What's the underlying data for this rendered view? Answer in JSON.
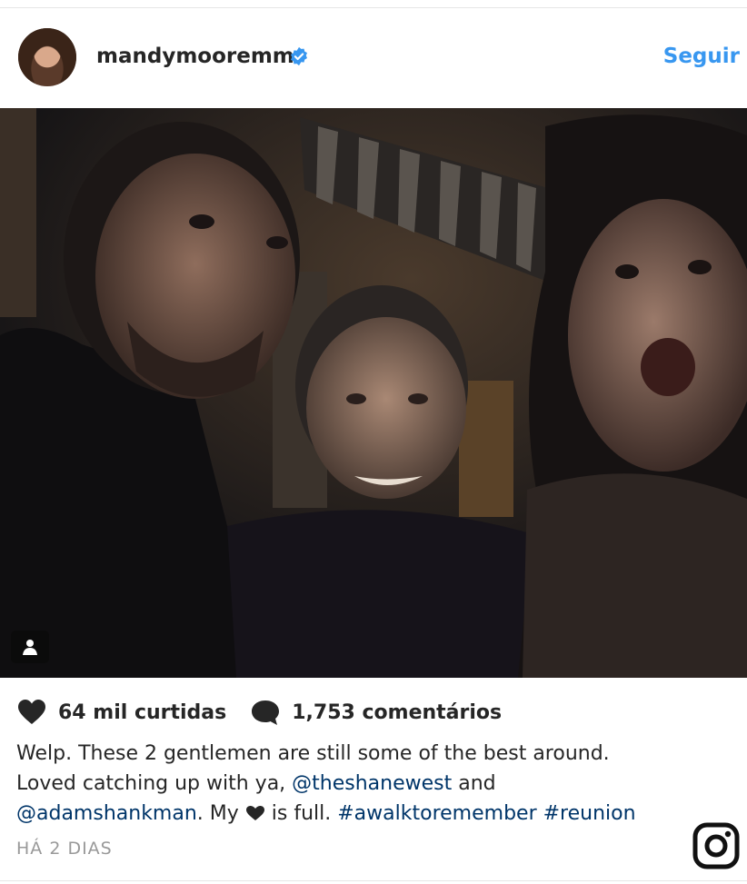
{
  "post": {
    "username": "mandymooremm",
    "follow_label": "Seguir",
    "likes_label": "64 mil curtidas",
    "comments_label": "1,753 comentários",
    "caption": {
      "line1": "Welp. These 2 gentlemen are still some of the best around.",
      "line2_prefix": "Loved catching up with ya, ",
      "mention1": "@theshanewest",
      "line2_suffix": " and",
      "mention2": "@adamshankman",
      "line3_mid": ". My ",
      "line3_after_heart": " is full. ",
      "hashtag1": "#awalktoremember",
      "hashtag2": "#reunion"
    },
    "date": "HÁ 2 DIAS"
  },
  "icons": {
    "verified": "verified-badge-icon",
    "like": "heart-icon",
    "comment": "comment-bubble-icon",
    "tag": "user-tag-icon",
    "brand": "instagram-logo-icon"
  },
  "colors": {
    "accent": "#3897f0",
    "link": "#003569",
    "muted": "#999999",
    "text": "#262626"
  }
}
